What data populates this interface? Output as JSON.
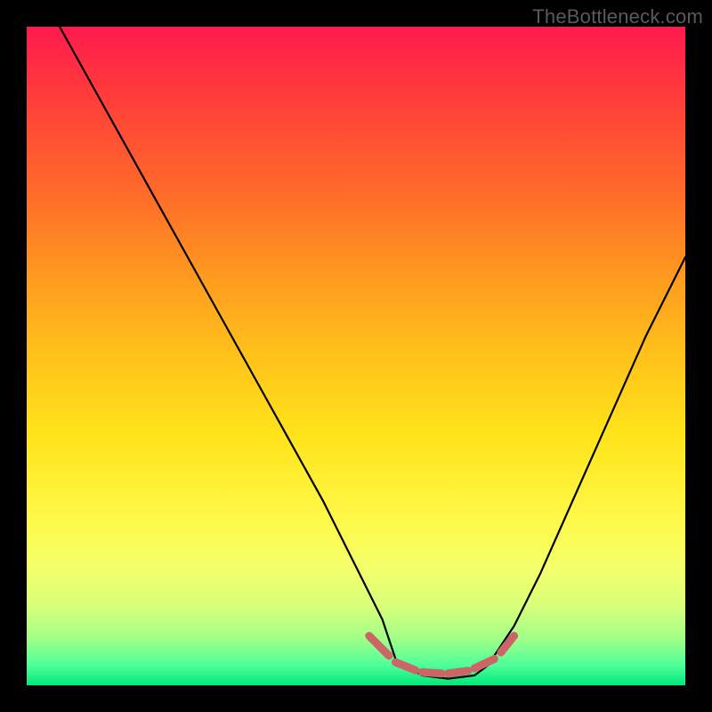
{
  "watermark": "TheBottleneck.com",
  "colors": {
    "curve_stroke": "#000000",
    "marker_fill": "#cc6666",
    "gradient_top": "#ff1a4d",
    "gradient_bottom": "#00e87b",
    "frame": "#000000"
  },
  "chart_data": {
    "type": "line",
    "title": "",
    "xlabel": "",
    "ylabel": "",
    "xlim": [
      0,
      100
    ],
    "ylim": [
      0,
      100
    ],
    "grid": false,
    "note": "Axes unlabeled; values are normalized percentages of the plot area read from the image. Curve is a V/valley shape with a flat bottom segment around x≈56–70. Higher y = toward top (red); floor = bottom (green).",
    "series": [
      {
        "name": "curve",
        "x": [
          0,
          5,
          10,
          15,
          20,
          25,
          30,
          35,
          40,
          45,
          50,
          54,
          56,
          60,
          64,
          68,
          70,
          74,
          78,
          82,
          86,
          90,
          94,
          98,
          100
        ],
        "y": [
          108,
          100,
          91,
          82,
          73,
          64,
          55,
          46,
          37,
          28,
          18,
          10,
          4,
          1.5,
          1.0,
          1.5,
          3,
          9,
          17,
          26,
          35,
          44,
          53,
          61,
          65
        ]
      }
    ],
    "markers": {
      "name": "floor-dashes",
      "note": "Short salmon dashed segments along the valley floor, roughly x≈53–73.",
      "segments": [
        {
          "x0": 52,
          "y0": 7.5,
          "x1": 55,
          "y1": 4.5
        },
        {
          "x0": 56,
          "y0": 3.5,
          "x1": 59,
          "y1": 2.3
        },
        {
          "x0": 60,
          "y0": 2.0,
          "x1": 63,
          "y1": 1.8
        },
        {
          "x0": 64,
          "y0": 1.8,
          "x1": 67,
          "y1": 2.2
        },
        {
          "x0": 68,
          "y0": 2.6,
          "x1": 71,
          "y1": 4.0
        },
        {
          "x0": 72,
          "y0": 5.0,
          "x1": 74,
          "y1": 7.5
        }
      ]
    }
  }
}
